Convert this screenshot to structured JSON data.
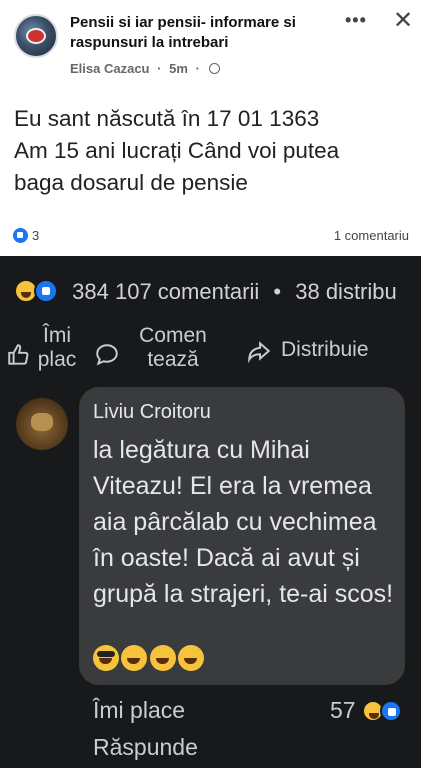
{
  "post": {
    "group_name": "Pensii si iar pensii- informare si raspunsuri la intrebari",
    "author": "Elisa Cazacu",
    "time": "5m",
    "separator": "·",
    "text_lines": [
      "Eu sant născută în 17 01 1363",
      "Am 15 ani lucrați Când voi putea",
      "baga dosarul de pensie"
    ],
    "reactions_count": "3",
    "comments_count": "1 comentariu",
    "more_icon": "more-horizontal-icon",
    "close_icon": "close-icon",
    "like_color": "#1877f2"
  },
  "share_stats": {
    "reactions": "384",
    "comments": "107 comentarii",
    "separator": "•",
    "shares": "38 distribu"
  },
  "actions": {
    "like_label": "Îmi plac",
    "comment_label": "Comen tează",
    "share_label": "Distribuie"
  },
  "comment": {
    "author": "Liviu Croitoru",
    "text": "la legătura cu Mihai Viteazu! El era la vremea aia pârcălab cu vechimea în oaste! Dacă ai avut și grupă la strajeri, te-ai scos!",
    "emojis": [
      "sunglasses-emoji-icon",
      "rolling-laughing-emoji-icon",
      "laughing-emoji-icon",
      "winking-tongue-emoji-icon"
    ],
    "like_label": "Îmi place",
    "reply_label": "Răspunde",
    "reactions_count": "57"
  },
  "colors": {
    "dark_background": "#18191a",
    "bubble": "#3a3b3c",
    "text_light": "#e4e6eb"
  }
}
